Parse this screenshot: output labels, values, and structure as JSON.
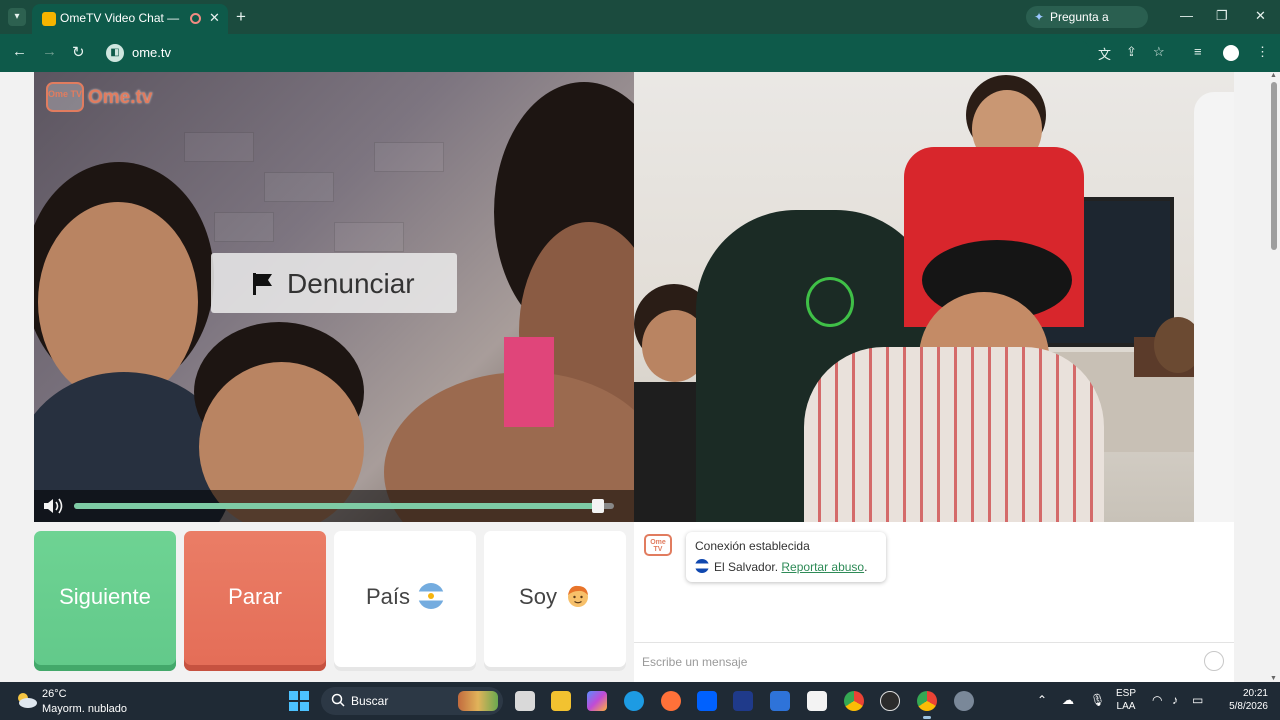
{
  "browser": {
    "tab_title": "OmeTV Video Chat — Ome",
    "tab_menu_icon": "chevron-down-icon",
    "new_tab_icon": "plus-icon",
    "gemini_label": "Pregunta a Gemini",
    "url": "ome.tv",
    "colors": {
      "tabstrip": "#1b4b3e",
      "toolbar": "#0e5a4a"
    }
  },
  "app": {
    "logo_tv": "Ome TV",
    "logo_word": "Ome.tv",
    "report_button": "Denunciar",
    "volume_level": 0.97,
    "buttons": {
      "next": "Siguiente",
      "stop": "Parar",
      "country": "País",
      "soy": "Soy"
    },
    "colors": {
      "next": "#62c98a",
      "stop": "#e46d57",
      "accent": "#e17c5f",
      "link": "#2e8b57"
    }
  },
  "chat": {
    "logo": "Ome TV",
    "status": "Conexión establecida",
    "country": "El Salvador.",
    "report_link": "Reportar abuso",
    "report_suffix": ".",
    "input_placeholder": "Escribe un mensaje"
  },
  "taskbar": {
    "weather_temp": "26°C",
    "weather_desc": "Mayorm. nublado",
    "search_label": "Buscar",
    "lang_line1": "ESP",
    "lang_line2": "LAA",
    "time": "20:21",
    "date": "5/8/2026"
  }
}
